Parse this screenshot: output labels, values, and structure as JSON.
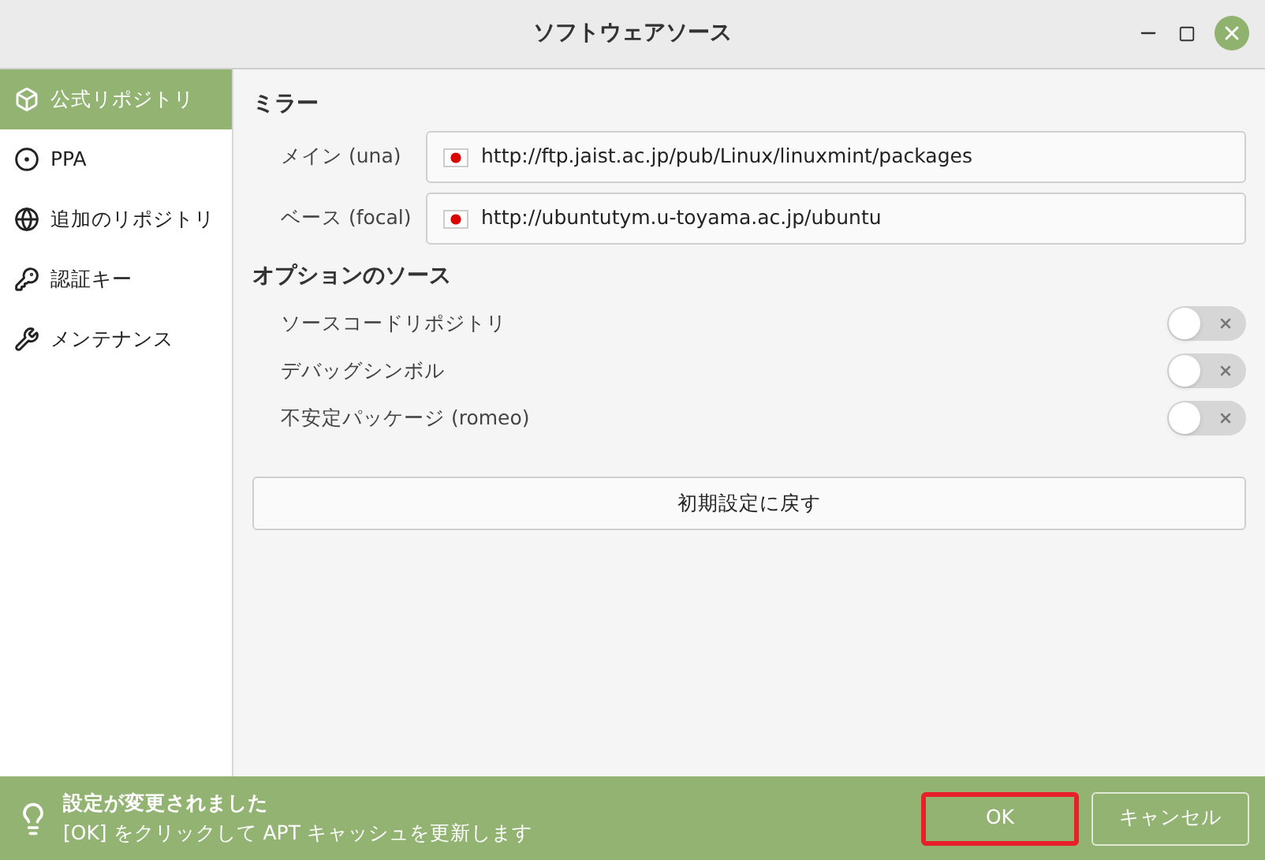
{
  "window": {
    "title": "ソフトウェアソース"
  },
  "sidebar": {
    "items": [
      {
        "label": "公式リポジトリ",
        "selected": true
      },
      {
        "label": "PPA",
        "selected": false
      },
      {
        "label": "追加のリポジトリ",
        "selected": false
      },
      {
        "label": "認証キー",
        "selected": false
      },
      {
        "label": "メンテナンス",
        "selected": false
      }
    ]
  },
  "mirrors": {
    "heading": "ミラー",
    "rows": [
      {
        "label": "メイン (una)",
        "value": "http://ftp.jaist.ac.jp/pub/Linux/linuxmint/packages"
      },
      {
        "label": "ベース (focal)",
        "value": "http://ubuntutym.u-toyama.ac.jp/ubuntu"
      }
    ]
  },
  "optional_sources": {
    "heading": "オプションのソース",
    "rows": [
      {
        "label": "ソースコードリポジトリ",
        "on": false
      },
      {
        "label": "デバッグシンボル",
        "on": false
      },
      {
        "label": "不安定パッケージ (romeo)",
        "on": false
      }
    ]
  },
  "reset_button": "初期設定に戻す",
  "notification": {
    "title": "設定が変更されました",
    "message": "[OK] をクリックして APT キャッシュを更新します"
  },
  "buttons": [
    {
      "label": "OK",
      "highlighted": true
    },
    {
      "label": "キャンセル",
      "highlighted": false
    }
  ]
}
